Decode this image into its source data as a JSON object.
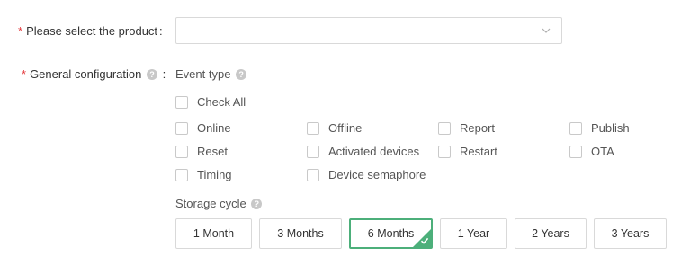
{
  "form": {
    "product": {
      "required_mark": "*",
      "label": "Please select the product",
      "colon": ":",
      "value": ""
    },
    "general": {
      "required_mark": "*",
      "label": "General configuration",
      "colon": ":",
      "help_glyph": "?"
    },
    "event_type": {
      "label": "Event type",
      "help_glyph": "?",
      "check_all": "Check All",
      "options": [
        "Online",
        "Offline",
        "Report",
        "Publish",
        "Reset",
        "Activated devices",
        "Restart",
        "OTA",
        "Timing",
        "Device semaphore"
      ],
      "checked": []
    },
    "storage_cycle": {
      "label": "Storage cycle",
      "help_glyph": "?",
      "options": [
        "1 Month",
        "3 Months",
        "6 Months",
        "1 Year",
        "2 Years",
        "3 Years"
      ],
      "selected": "6 Months"
    }
  },
  "colors": {
    "accent": "#4caf7a",
    "required": "#e4393c",
    "border": "#d9d9d9"
  },
  "icons": {
    "select_arrow": "chevron-down-icon",
    "help": "question-circle-icon",
    "selected_check": "check-icon"
  }
}
